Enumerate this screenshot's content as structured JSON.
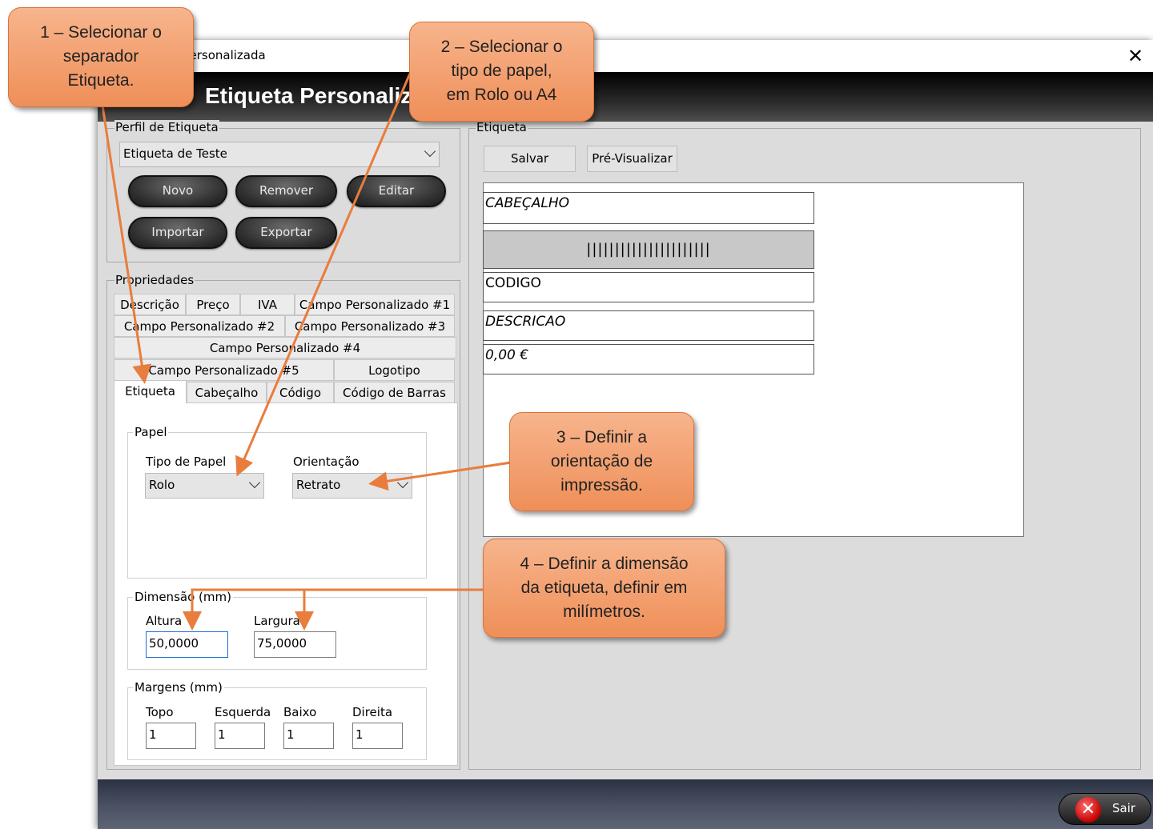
{
  "window": {
    "title": "Personalizada",
    "header_title": "Etiqueta Personalizada",
    "close_icon": "close-icon"
  },
  "profile": {
    "group_label": "Perfil de Etiqueta",
    "selected": "Etiqueta de Teste",
    "buttons": {
      "new": "Novo",
      "remove": "Remover",
      "edit": "Editar",
      "import": "Importar",
      "export": "Exportar"
    }
  },
  "properties": {
    "group_label": "Propriedades",
    "tabs": {
      "descricao": "Descrição",
      "preco": "Preço",
      "iva": "IVA",
      "cp1": "Campo Personalizado #1",
      "cp2": "Campo Personalizado #2",
      "cp3": "Campo Personalizado #3",
      "cp4": "Campo Personalizado #4",
      "cp5": "Campo Personalizado #5",
      "logotipo": "Logotipo",
      "etiqueta": "Etiqueta",
      "cabecalho": "Cabeçalho",
      "codigo": "Código",
      "codigo_barras": "Código de Barras"
    },
    "papel": {
      "group_label": "Papel",
      "tipo_label": "Tipo de Papel",
      "tipo_value": "Rolo",
      "orient_label": "Orientação",
      "orient_value": "Retrato"
    },
    "dimensao": {
      "group_label": "Dimensão (mm)",
      "altura_label": "Altura",
      "altura_value": "50,0000",
      "largura_label": "Largura",
      "largura_value": "75,0000"
    },
    "margens": {
      "group_label": "Margens (mm)",
      "topo_label": "Topo",
      "topo_value": "1",
      "esquerda_label": "Esquerda",
      "esquerda_value": "1",
      "baixo_label": "Baixo",
      "baixo_value": "1",
      "direita_label": "Direita",
      "direita_value": "1"
    }
  },
  "label_panel": {
    "group_label": "Etiqueta",
    "save": "Salvar",
    "preview": "Pré-Visualizar",
    "fields": {
      "header": "CABEÇALHO",
      "barcode": "||||||||||||||||||||||",
      "code": "CODIGO",
      "description": "DESCRICAO",
      "price": "0,00 €"
    }
  },
  "footer": {
    "exit": "Sair",
    "exit_icon": "exit-x-icon"
  },
  "callouts": {
    "c1": "1 – Selecionar o\nseparador\nEtiqueta.",
    "c2": "2 – Selecionar o\ntipo de papel,\nem Rolo ou A4",
    "c3": "3 –  Definir a\norientação de\nimpressão.",
    "c4": "4 – Definir a dimensão\nda etiqueta, definir em\nmilímetros."
  },
  "colors": {
    "callout_fill": "#f5a47a",
    "arrow": "#e87d3e",
    "header_bg": "#000000",
    "focus": "#1a6fd1"
  }
}
